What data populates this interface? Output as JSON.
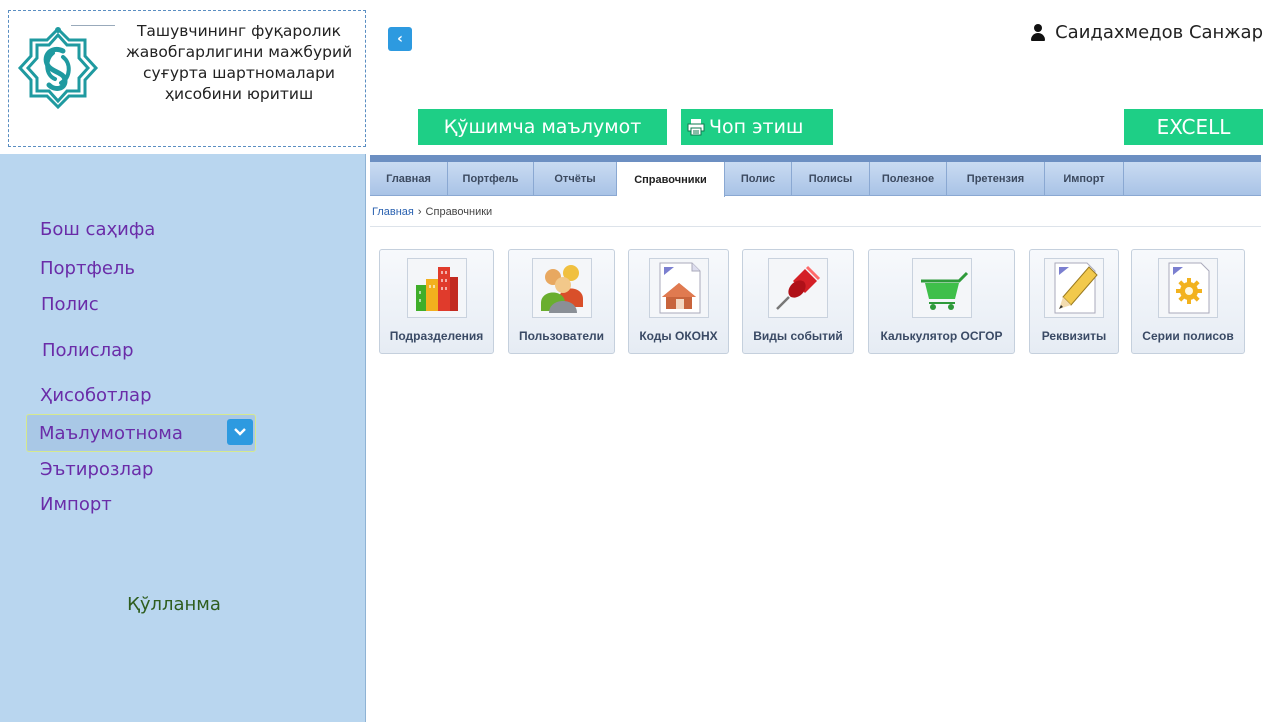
{
  "header": {
    "app_title": "Ташувчининг фуқаролик жавобгарлигини мажбурий суғурта шартномалари ҳисобини юритиш",
    "user_name": "Саидахмедов Санжар"
  },
  "actions": {
    "extra_info": "Қўшимча маълумот",
    "print": "Чоп этиш",
    "excel": "EXCELL"
  },
  "sidebar": {
    "items": [
      {
        "label": "Бош саҳифа"
      },
      {
        "label": "Портфель"
      },
      {
        "label": "Полис"
      },
      {
        "label": "Полислар"
      },
      {
        "label": "Ҳисоботлар"
      },
      {
        "label": "Маълумотнома"
      },
      {
        "label": "Эътирозлар"
      },
      {
        "label": "Импорт"
      }
    ],
    "manual": "Қўлланма"
  },
  "tabs": [
    {
      "label": "Главная"
    },
    {
      "label": "Портфель"
    },
    {
      "label": "Отчёты"
    },
    {
      "label": "Справочники"
    },
    {
      "label": "Полис"
    },
    {
      "label": "Полисы"
    },
    {
      "label": "Полезное"
    },
    {
      "label": "Претензия"
    },
    {
      "label": "Импорт"
    }
  ],
  "active_tab": "Справочники",
  "breadcrumb": {
    "home": "Главная",
    "separator": "›",
    "current": "Справочники"
  },
  "tiles": [
    {
      "label": "Подразделения",
      "icon": "buildings-icon"
    },
    {
      "label": "Пользователи",
      "icon": "users-icon"
    },
    {
      "label": "Коды ОКОНХ",
      "icon": "house-document-icon"
    },
    {
      "label": "Виды событий",
      "icon": "pushpin-icon"
    },
    {
      "label": "Калькулятор ОСГОР",
      "icon": "cart-icon"
    },
    {
      "label": "Реквизиты",
      "icon": "pencil-document-icon"
    },
    {
      "label": "Серии полисов",
      "icon": "gear-document-icon"
    }
  ],
  "colors": {
    "accent_green": "#1ecf86",
    "accent_blue": "#2d9ae0",
    "sidebar_bg": "#b9d6ef",
    "nav_text": "#6a2ca8"
  }
}
